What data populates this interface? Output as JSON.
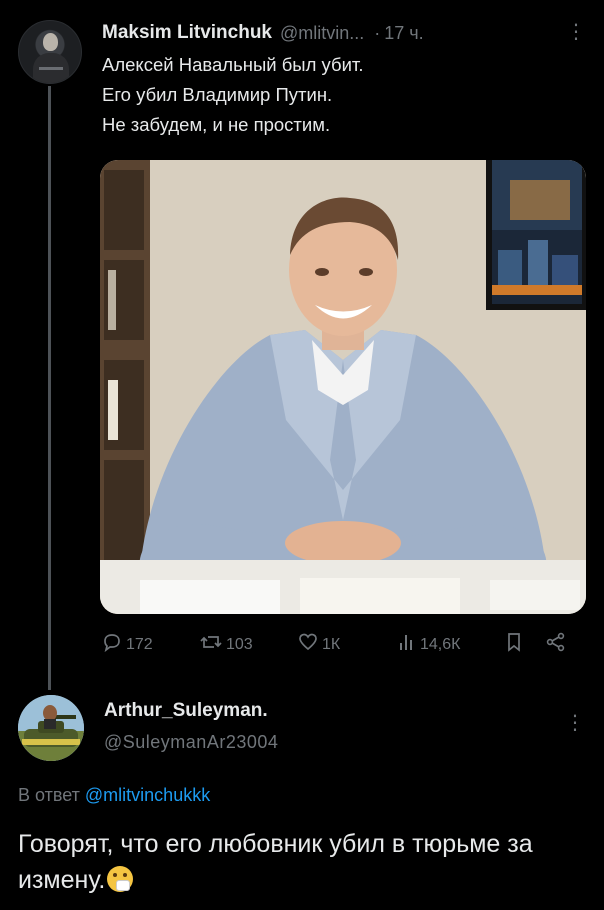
{
  "tweet": {
    "author_name": "Maksim Litvinchuk",
    "author_handle": "@mlitvin...",
    "separator": "·",
    "time": "17 ч.",
    "more": "⋮",
    "lines": [
      "Алексей Навальный был убит.",
      "Его убил Владимир Путин.",
      "Не забудем, и не простим."
    ],
    "stats": {
      "replies": "172",
      "reposts": "103",
      "likes": "1К",
      "views": "14,6К"
    }
  },
  "reply": {
    "author_name": "Arthur_Suleyman.",
    "author_handle": "@SuleymanAr23004",
    "more": "⋮",
    "reply_prefix": "В ответ",
    "reply_to_handle": "@mlitvinchukkk",
    "text": "Говорят, что его любовник убил в тюрьме за измену."
  },
  "icons": {
    "reply": "reply-icon",
    "repost": "repost-icon",
    "like": "heart-icon",
    "views": "views-icon",
    "bookmark": "bookmark-icon",
    "share": "share-icon"
  },
  "colors": {
    "background": "#000000",
    "text": "#e7e9ea",
    "muted": "#71767b",
    "link": "#1d9bf0",
    "thread_line": "#4d5257"
  }
}
